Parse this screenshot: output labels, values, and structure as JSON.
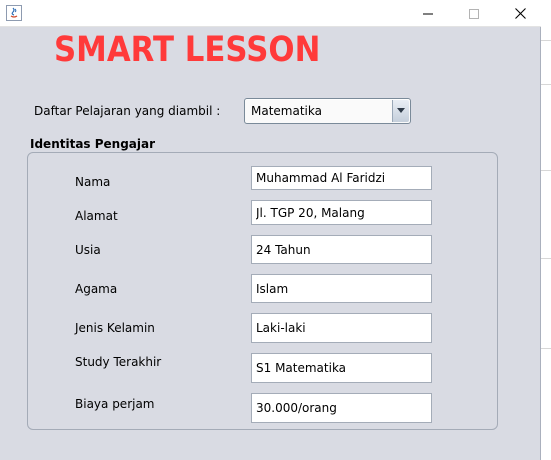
{
  "window": {
    "controls": {
      "minimize_icon": "minimize-icon",
      "maximize_icon": "maximize-icon",
      "close_icon": "close-icon"
    }
  },
  "header": {
    "title": "SMART LESSON"
  },
  "subject": {
    "label": "Daftar Pelajaran yang diambil :",
    "selected": "Matematika"
  },
  "teacher": {
    "group_title": "Identitas Pengajar",
    "fields": [
      {
        "label": "Nama",
        "value": "Muhammad Al Faridzi"
      },
      {
        "label": "Alamat",
        "value": "Jl. TGP 20, Malang"
      },
      {
        "label": "Usia",
        "value": "24 Tahun"
      },
      {
        "label": "Agama",
        "value": "Islam"
      },
      {
        "label": "Jenis Kelamin",
        "value": "Laki-laki"
      },
      {
        "label": "Study Terakhir",
        "value": "S1 Matematika"
      },
      {
        "label": "Biaya perjam",
        "value": "30.000/orang"
      }
    ]
  },
  "colors": {
    "title_red": "#ff3a3a",
    "window_bg": "#d9dbe3"
  }
}
